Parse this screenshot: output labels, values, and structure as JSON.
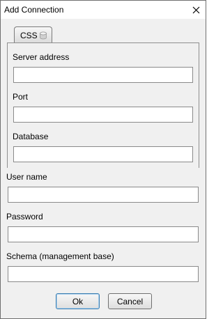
{
  "window": {
    "title": "Add Connection"
  },
  "tab": {
    "label": "CSS",
    "icon": "database-icon"
  },
  "css_panel": {
    "server_address_label": "Server address",
    "server_address_value": "",
    "port_label": "Port",
    "port_value": "",
    "database_label": "Database",
    "database_value": ""
  },
  "user_name_label": "User name",
  "user_name_value": "",
  "password_label": "Password",
  "password_value": "",
  "schema_label": "Schema (management base)",
  "schema_value": "",
  "buttons": {
    "ok": "Ok",
    "cancel": "Cancel"
  }
}
